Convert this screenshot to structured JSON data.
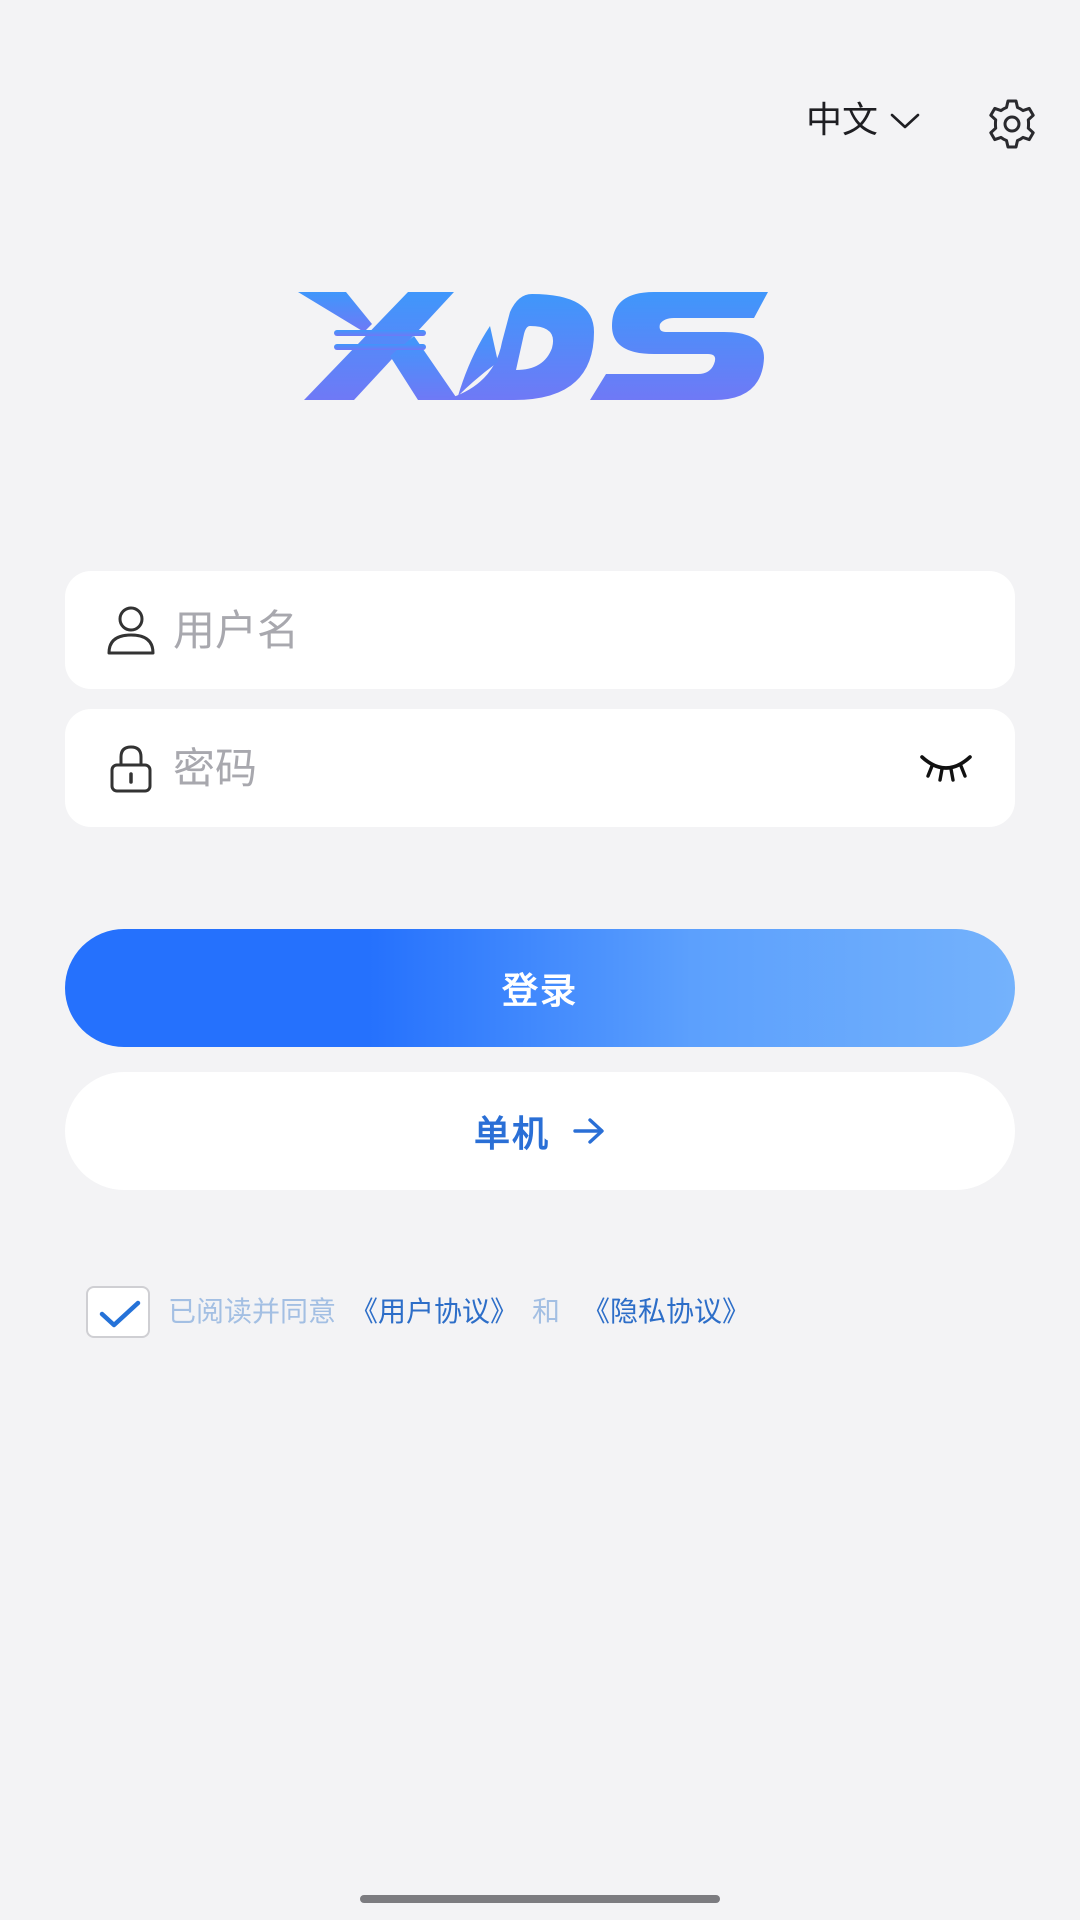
{
  "header": {
    "language_label": "中文",
    "language_icon": "chevron-down-icon",
    "settings_icon": "gear-icon"
  },
  "logo": {
    "text": "XDS",
    "colors": [
      "#3f97fb",
      "#6f79f6"
    ]
  },
  "form": {
    "username": {
      "placeholder": "用户名",
      "value": "",
      "icon": "user-icon"
    },
    "password": {
      "placeholder": "密码",
      "value": "",
      "icon": "lock-icon",
      "toggle_icon": "eye-closed-icon"
    }
  },
  "actions": {
    "login_label": "登录",
    "offline_label": "单机",
    "offline_icon": "arrow-right-icon"
  },
  "agreement": {
    "checked": true,
    "prefix": "已阅读并同意",
    "user_agreement": "《用户协议》",
    "and": "和",
    "privacy_policy": "《隐私协议》"
  },
  "colors": {
    "background": "#f3f3f5",
    "primary": "#2571fd",
    "gradient_end": "#74b2fc",
    "link": "#2d6ec8",
    "muted_text": "#a3bfe3"
  }
}
